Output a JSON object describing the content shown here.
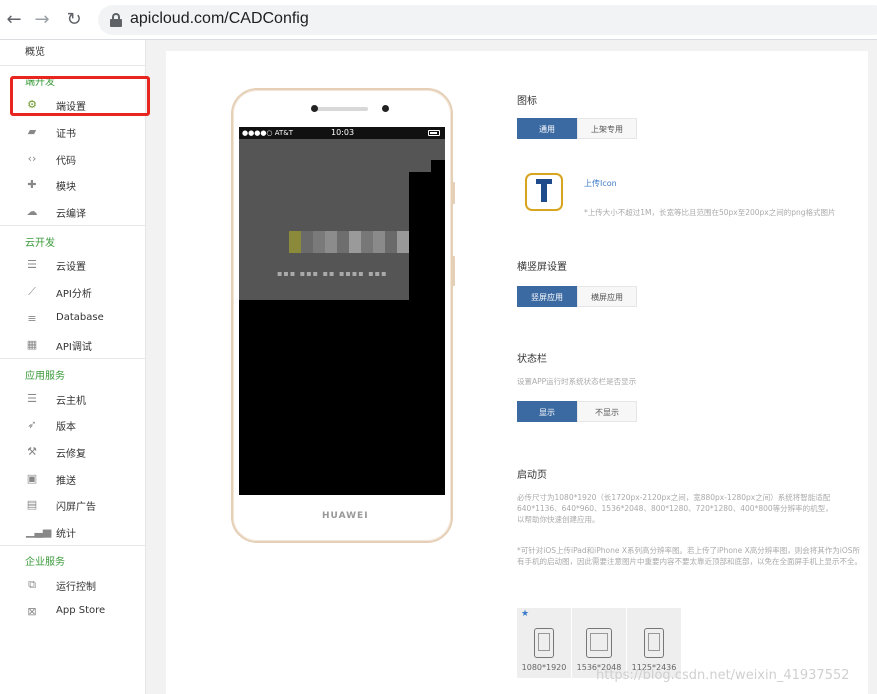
{
  "browser": {
    "url": "apicloud.com/CADConfig"
  },
  "sidebar": {
    "overview": "概览",
    "sections": [
      {
        "title": "端开发",
        "items": [
          {
            "label": "端设置",
            "icon": "gear-icon"
          },
          {
            "label": "证书",
            "icon": "certificate-icon"
          },
          {
            "label": "代码",
            "icon": "code-icon"
          },
          {
            "label": "模块",
            "icon": "puzzle-icon"
          },
          {
            "label": "云编译",
            "icon": "cloud-icon"
          }
        ]
      },
      {
        "title": "云开发",
        "items": [
          {
            "label": "云设置",
            "icon": "sliders-icon"
          },
          {
            "label": "API分析",
            "icon": "chart-icon"
          },
          {
            "label": "Database",
            "icon": "database-icon"
          },
          {
            "label": "API调试",
            "icon": "debug-icon"
          }
        ]
      },
      {
        "title": "应用服务",
        "items": [
          {
            "label": "云主机",
            "icon": "server-icon"
          },
          {
            "label": "版本",
            "icon": "rocket-icon"
          },
          {
            "label": "云修复",
            "icon": "wrench-icon"
          },
          {
            "label": "推送",
            "icon": "push-icon"
          },
          {
            "label": "闪屏广告",
            "icon": "billboard-icon"
          },
          {
            "label": "统计",
            "icon": "stats-icon"
          }
        ]
      },
      {
        "title": "企业服务",
        "items": [
          {
            "label": "运行控制",
            "icon": "control-icon"
          },
          {
            "label": "App Store",
            "icon": "store-icon"
          }
        ]
      }
    ]
  },
  "phone": {
    "carrier": "●●●●○ AT&T",
    "time": "10:03",
    "brand": "HUAWEI"
  },
  "config": {
    "icon": {
      "title": "图标",
      "tabs": [
        "通用",
        "上架专用"
      ],
      "upload_label": "上传Icon",
      "hint": "*上传大小不超过1M，长宽等比且范围在50px至200px之间的png格式图片"
    },
    "orientation": {
      "title": "横竖屏设置",
      "tabs": [
        "竖屏应用",
        "横屏应用"
      ]
    },
    "statusbar": {
      "title": "状态栏",
      "hint": "设置APP运行时系统状态栏是否显示",
      "tabs": [
        "显示",
        "不显示"
      ]
    },
    "launch": {
      "title": "启动页",
      "hint1": "必传尺寸为1080*1920（长1720px-2120px之间，宽880px-1280px之间）系统将智能适配640*1136、640*960、1536*2048、800*1280、720*1280、400*800等分辨率的机型，以帮助你快速创建应用。",
      "hint2": "*可针对iOS上传iPad和iPhone X系列高分辨率图。若上传了iPhone X高分辨率图，则会将其作为iOS所有手机的启动图，因此需要注意图片中重要内容不要太靠近顶部和底部，以免在全面屏手机上显示不全。",
      "thumbs": [
        "1080*1920",
        "1536*2048",
        "1125*2436"
      ]
    }
  },
  "watermark": "https://blog.csdn.net/weixin_41937552"
}
